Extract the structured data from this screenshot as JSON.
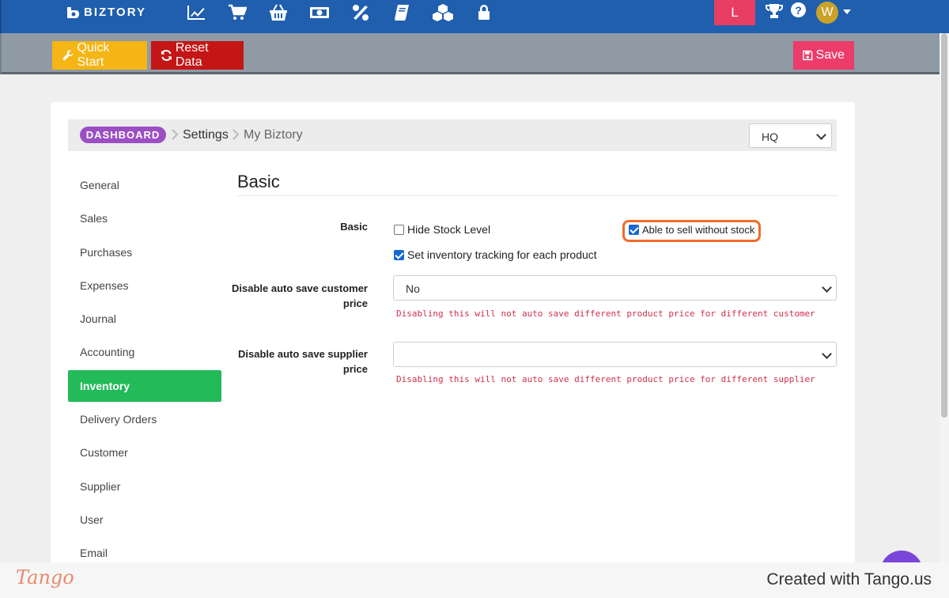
{
  "app": {
    "brand": "BIZTORY",
    "brand_color": "#1f5fae"
  },
  "navbar": {
    "icons": [
      "chart-line-icon",
      "shopping-cart-icon",
      "basket-icon",
      "money-icon",
      "percent-icon",
      "book-icon",
      "cubes-icon",
      "lock-icon"
    ],
    "user_badge": "L",
    "avatar_initial": "W"
  },
  "actions": {
    "quick_start": "Quick Start",
    "reset_data": "Reset Data",
    "save": "Save"
  },
  "breadcrumb": {
    "root": "DASHBOARD",
    "items": [
      "Settings",
      "My Biztory"
    ],
    "location": "HQ"
  },
  "sidebar": {
    "items": [
      {
        "label": "General",
        "active": false
      },
      {
        "label": "Sales",
        "active": false
      },
      {
        "label": "Purchases",
        "active": false
      },
      {
        "label": "Expenses",
        "active": false
      },
      {
        "label": "Journal",
        "active": false
      },
      {
        "label": "Accounting",
        "active": false
      },
      {
        "label": "Inventory",
        "active": true
      },
      {
        "label": "Delivery Orders",
        "active": false
      },
      {
        "label": "Customer",
        "active": false
      },
      {
        "label": "Supplier",
        "active": false
      },
      {
        "label": "User",
        "active": false
      },
      {
        "label": "Email",
        "active": false
      }
    ]
  },
  "main": {
    "section_title": "Basic",
    "basic": {
      "label": "Basic",
      "options": [
        {
          "label": "Hide Stock Level",
          "checked": false
        },
        {
          "label": "Able to sell without stock",
          "checked": true
        },
        {
          "label": "Set inventory tracking for each product",
          "checked": true
        }
      ]
    },
    "customer_price": {
      "label_line1": "Disable auto save customer",
      "label_line2": "price",
      "value": "No",
      "hint": "Disabling this will not auto save different product price for different customer"
    },
    "supplier_price": {
      "label_line1": "Disable auto save supplier",
      "label_line2": "price",
      "value": "",
      "hint": "Disabling this will not auto save different product price for different supplier"
    }
  },
  "footer": {
    "logo": "Tango",
    "credit": "Created with Tango.us"
  }
}
